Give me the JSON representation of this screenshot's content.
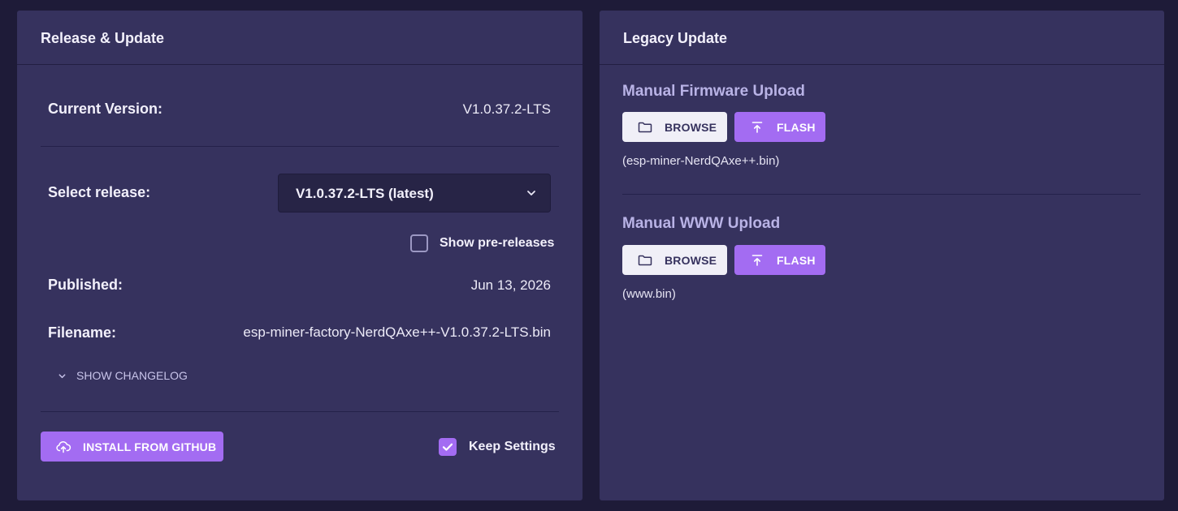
{
  "left_panel": {
    "title": "Release & Update",
    "current_version": {
      "label": "Current Version:",
      "value": "V1.0.37.2-LTS"
    },
    "select_release": {
      "label": "Select release:",
      "selected": "V1.0.37.2-LTS (latest)"
    },
    "show_prereleases": {
      "label": "Show pre-releases",
      "checked": false
    },
    "published": {
      "label": "Published:",
      "value": "Jun 13, 2026"
    },
    "filename": {
      "label": "Filename:",
      "value": "esp-miner-factory-NerdQAxe++-V1.0.37.2-LTS.bin"
    },
    "changelog_label": "SHOW CHANGELOG",
    "install_button": "INSTALL FROM GITHUB",
    "keep_settings": {
      "label": "Keep Settings",
      "checked": true
    }
  },
  "right_panel": {
    "title": "Legacy Update",
    "firmware": {
      "title": "Manual Firmware Upload",
      "browse_label": "BROWSE",
      "flash_label": "FLASH",
      "hint": "(esp-miner-NerdQAxe++.bin)"
    },
    "www": {
      "title": "Manual WWW Upload",
      "browse_label": "BROWSE",
      "flash_label": "FLASH",
      "hint": "(www.bin)"
    }
  },
  "colors": {
    "background": "#1e1b38",
    "panel": "#36325e",
    "accent": "#a36cf2",
    "section_title": "#b9b3e6"
  },
  "icons": [
    "chevron-down-icon",
    "folder-icon",
    "upload-icon",
    "cloud-upload-icon",
    "checkmark-icon"
  ]
}
